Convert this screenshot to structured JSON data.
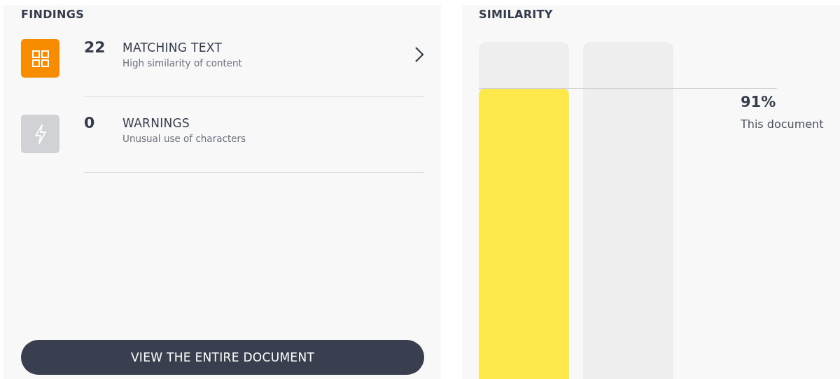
{
  "findings": {
    "title": "FINDINGS",
    "items": [
      {
        "kind": "matching",
        "count": "22",
        "title": "MATCHING TEXT",
        "subtitle": "High similarity of content",
        "active": true,
        "expandable": true
      },
      {
        "kind": "warnings",
        "count": "0",
        "title": "WARNINGS",
        "subtitle": "Unusual use of characters",
        "active": false,
        "expandable": false
      }
    ],
    "button": "VIEW THE ENTIRE DOCUMENT"
  },
  "similarity": {
    "title": "SIMILARITY",
    "bars": [
      {
        "kind": "filled",
        "level": 0.91
      },
      {
        "kind": "empty"
      }
    ],
    "percent": "91%",
    "label": "This document"
  }
}
